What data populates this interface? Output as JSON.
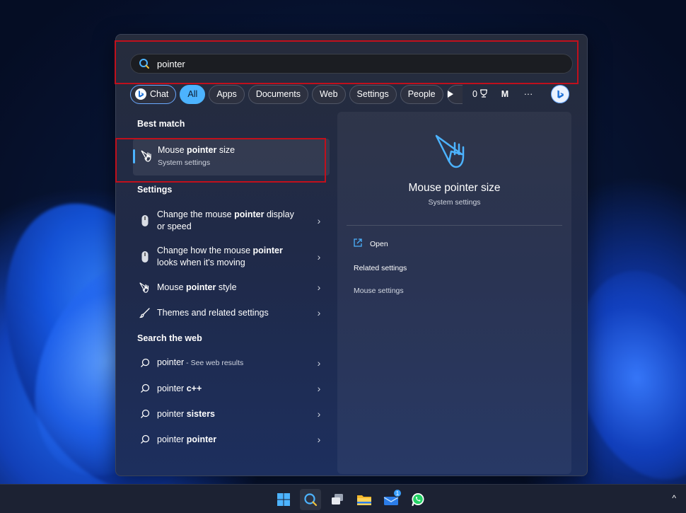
{
  "search": {
    "query": "pointer"
  },
  "filters": {
    "chat": "Chat",
    "all": "All",
    "apps": "Apps",
    "documents": "Documents",
    "web": "Web",
    "settings": "Settings",
    "people": "People",
    "rewards_count": "0",
    "account_initial": "M",
    "more": "···"
  },
  "sections": {
    "best_match": "Best match",
    "settings": "Settings",
    "search_web": "Search the web"
  },
  "best_match": {
    "title_pre": "Mouse ",
    "title_bold": "pointer",
    "title_post": " size",
    "subtitle": "System settings"
  },
  "settings_results": [
    {
      "line1_pre": "Change the mouse ",
      "bold": "pointer",
      "line1_post": " display",
      "line2": "or speed"
    },
    {
      "line1_pre": "Change how the mouse ",
      "bold": "pointer",
      "line1_post": "",
      "line2": "looks when it's moving"
    },
    {
      "line1_pre": "Mouse ",
      "bold": "pointer",
      "line1_post": " style",
      "line2": ""
    },
    {
      "line1_pre": "Themes and related settings",
      "bold": "",
      "line1_post": "",
      "line2": ""
    }
  ],
  "web_results": [
    {
      "pre": "pointer",
      "bold": "",
      "suffix": " - See web results"
    },
    {
      "pre": "pointer ",
      "bold": "c++",
      "suffix": ""
    },
    {
      "pre": "pointer ",
      "bold": "sisters",
      "suffix": ""
    },
    {
      "pre": "pointer ",
      "bold": "pointer",
      "suffix": ""
    }
  ],
  "preview": {
    "title": "Mouse pointer size",
    "subtitle": "System settings",
    "open": "Open",
    "related": "Related settings",
    "mouse_settings": "Mouse settings"
  },
  "taskbar": {
    "mail_badge": "1",
    "tray_chevron": "^"
  },
  "colors": {
    "accent": "#4cb3ff",
    "highlight_border": "#c0101c"
  }
}
